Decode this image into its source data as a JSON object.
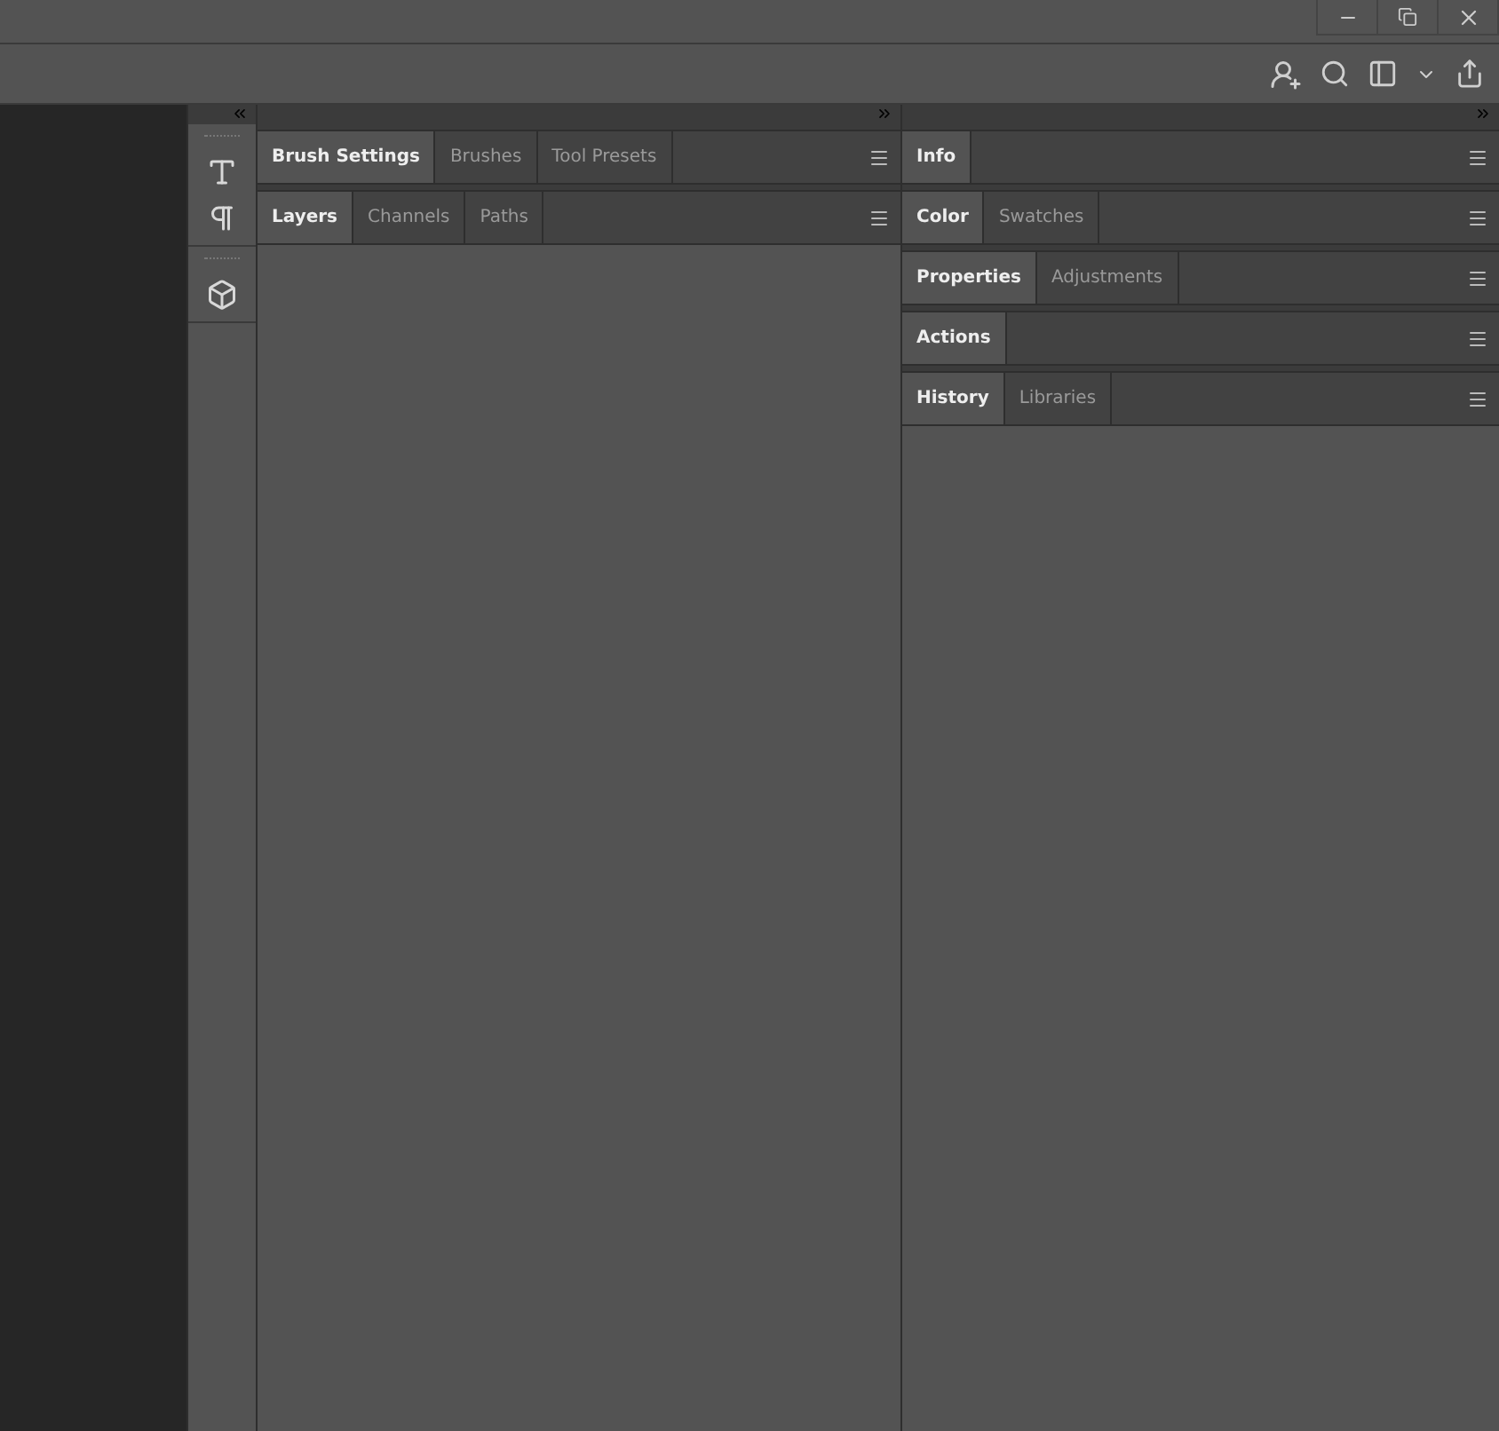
{
  "columns": [
    {
      "kind": "tools"
    },
    {
      "kind": "panels",
      "groups": [
        {
          "expanded": false,
          "tabs": [
            {
              "label": "Brush Settings",
              "selected": true
            },
            {
              "label": "Brushes",
              "selected": false
            },
            {
              "label": "Tool Presets",
              "selected": false
            }
          ]
        },
        {
          "expanded": true,
          "tabs": [
            {
              "label": "Layers",
              "selected": true
            },
            {
              "label": "Channels",
              "selected": false
            },
            {
              "label": "Paths",
              "selected": false
            }
          ]
        }
      ]
    },
    {
      "kind": "panels",
      "groups": [
        {
          "expanded": false,
          "tabs": [
            {
              "label": "Info",
              "selected": true
            }
          ]
        },
        {
          "expanded": false,
          "tabs": [
            {
              "label": "Color",
              "selected": true
            },
            {
              "label": "Swatches",
              "selected": false
            }
          ]
        },
        {
          "expanded": false,
          "tabs": [
            {
              "label": "Properties",
              "selected": true
            },
            {
              "label": "Adjustments",
              "selected": false
            }
          ]
        },
        {
          "expanded": false,
          "tabs": [
            {
              "label": "Actions",
              "selected": true
            }
          ]
        },
        {
          "expanded": true,
          "tabs": [
            {
              "label": "History",
              "selected": true
            },
            {
              "label": "Libraries",
              "selected": false
            }
          ]
        }
      ]
    }
  ]
}
